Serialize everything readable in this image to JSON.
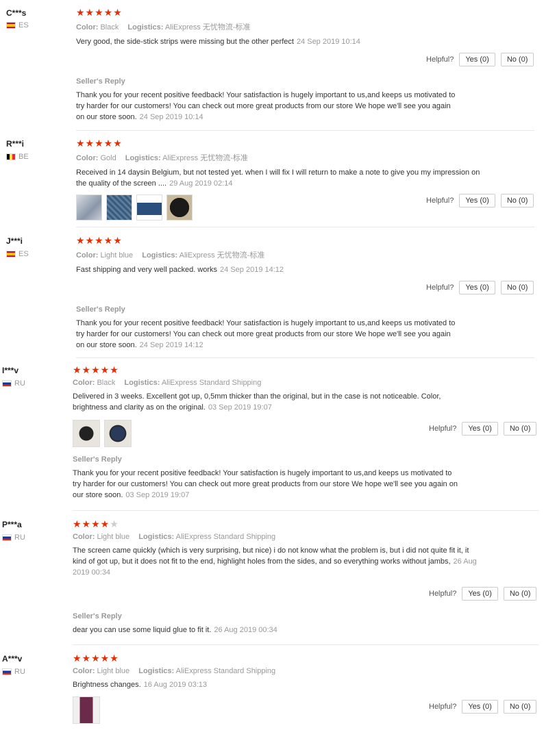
{
  "labels": {
    "color": "Color:",
    "logistics": "Logistics:",
    "helpful": "Helpful?",
    "seller_reply": "Seller's Reply"
  },
  "reviews": [
    {
      "user": "C***s",
      "country": "ES",
      "flag": "es",
      "stars": 5,
      "color": "Black",
      "logistics": "AliExpress 无忧物流-标准",
      "text": "Very good, the side-stick strips were missing but the other perfect",
      "date": "24 Sep 2019 10:14",
      "yes": "Yes (0)",
      "no": "No (0)",
      "reply": "Thank you for your recent positive feedback! Your satisfaction is hugely important to us,and keeps us motivated to try harder for our customers! You can check out more great products from our store We hope we'll see you again on our store soon.",
      "reply_date": "24 Sep 2019 10:14"
    },
    {
      "user": "R***i",
      "country": "BE",
      "flag": "be",
      "stars": 5,
      "color": "Gold",
      "logistics": "AliExpress 无忧物流-标准",
      "text": "Received in 14 daysin Belgium, but not tested yet. when I will fix I will return to make a note to give you my impression on the quality of the screen ....",
      "date": "29 Aug 2019 02:14",
      "yes": "Yes (0)",
      "no": "No (0)"
    },
    {
      "user": "J***i",
      "country": "ES",
      "flag": "es",
      "stars": 5,
      "color": "Light blue",
      "logistics": "AliExpress 无忧物流-标准",
      "text": "Fast shipping and very well packed. works",
      "date": "24 Sep 2019 14:12",
      "yes": "Yes (0)",
      "no": "No (0)",
      "reply": "Thank you for your recent positive feedback! Your satisfaction is hugely important to us,and keeps us motivated to try harder for our customers! You can check out more great products from our store We hope we'll see you again on our store soon.",
      "reply_date": "24 Sep 2019 14:12"
    },
    {
      "user": "I***v",
      "country": "RU",
      "flag": "ru",
      "stars": 5,
      "color": "Black",
      "logistics": "AliExpress Standard Shipping",
      "text": "Delivered in 3 weeks. Excellent got up, 0,5mm thicker than the original, but in the case is not noticeable. Color, brightness and clarity as on the original.",
      "date": "03 Sep 2019 19:07",
      "yes": "Yes (0)",
      "no": "No (0)",
      "reply": "Thank you for your recent positive feedback! Your satisfaction is hugely important to us,and keeps us motivated to try harder for our customers! You can check out more great products from our store We hope we'll see you again on our store soon.",
      "reply_date": "03 Sep 2019 19:07"
    },
    {
      "user": "P***a",
      "country": "RU",
      "flag": "ru",
      "stars": 4,
      "color": "Light blue",
      "logistics": "AliExpress Standard Shipping",
      "text": "The screen came quickly (which is very surprising, but nice) i do not know what the problem is, but i did not quite fit it, it kind of got up, but it does not fit to the end, highlight holes from the sides, and so everything works without jambs,",
      "date": "26 Aug 2019 00:34",
      "yes": "Yes (0)",
      "no": "No (0)",
      "reply": "dear you can use some liquid glue to fit it.",
      "reply_date": "26 Aug 2019 00:34"
    },
    {
      "user": "A***v",
      "country": "RU",
      "flag": "ru",
      "stars": 5,
      "color": "Light blue",
      "logistics": "AliExpress Standard Shipping",
      "text": "Brightness changes.",
      "date": "16 Aug 2019 03:13",
      "yes": "Yes (0)",
      "no": "No (0)"
    }
  ]
}
